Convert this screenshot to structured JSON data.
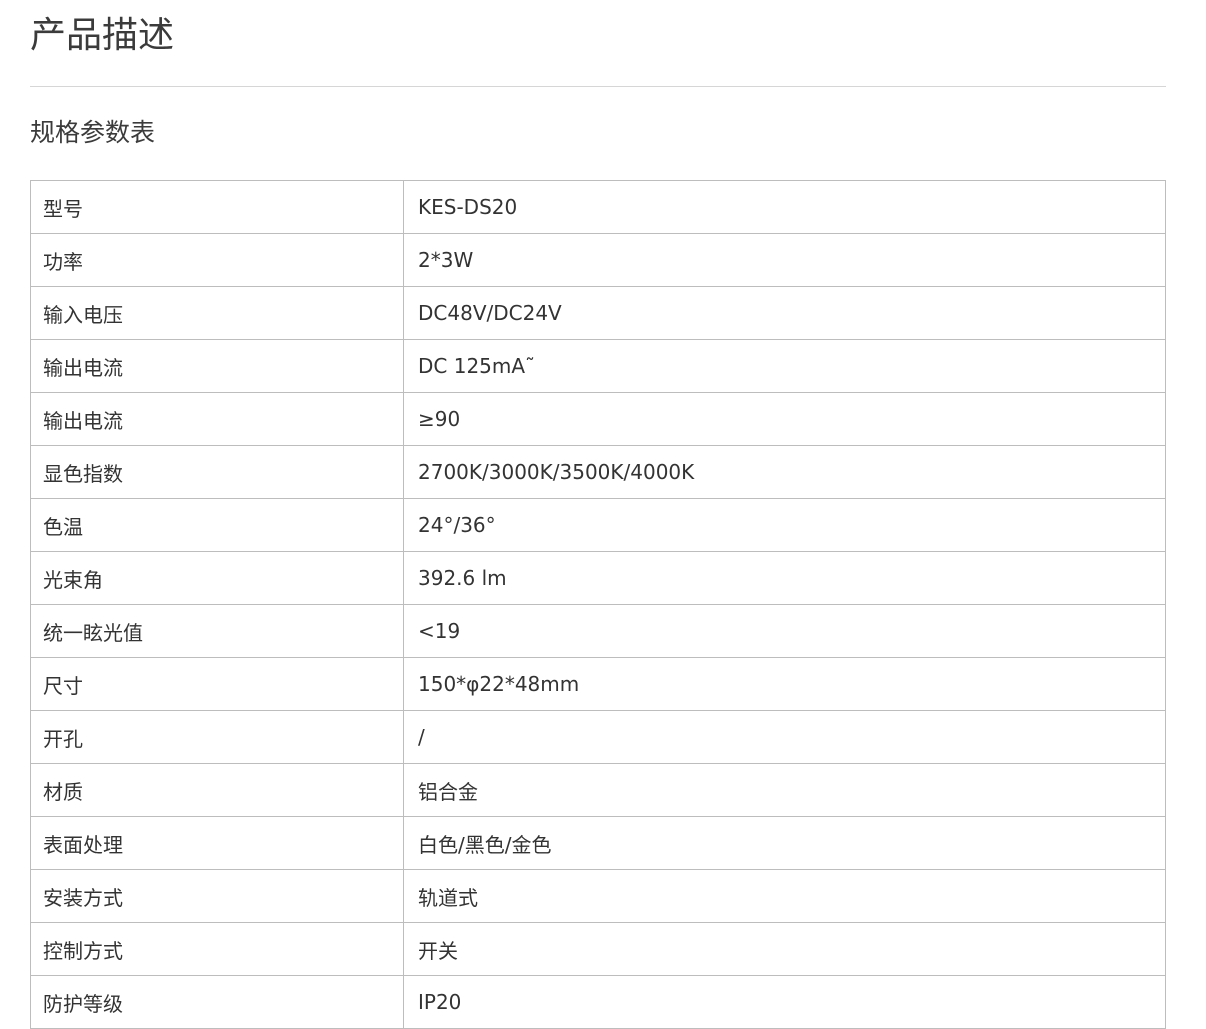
{
  "page": {
    "title": "产品描述",
    "section_title": "规格参数表"
  },
  "spec_table": {
    "rows": [
      {
        "label": "型号",
        "value": "KES-DS20"
      },
      {
        "label": "功率",
        "value": "2*3W"
      },
      {
        "label": "输入电压",
        "value": "DC48V/DC24V"
      },
      {
        "label": "输出电流",
        "value": "DC 125mA˜"
      },
      {
        "label": "输出电流",
        "value": "≥90"
      },
      {
        "label": "显色指数",
        "value": "2700K/3000K/3500K/4000K"
      },
      {
        "label": "色温",
        "value": "24°/36°"
      },
      {
        "label": "光束角",
        "value": "392.6 lm"
      },
      {
        "label": "统一眩光值",
        "value": "<19"
      },
      {
        "label": "尺寸",
        "value": "150*φ22*48mm"
      },
      {
        "label": "开孔",
        "value": "/"
      },
      {
        "label": "材质",
        "value": "铝合金"
      },
      {
        "label": "表面处理",
        "value": "白色/黑色/金色"
      },
      {
        "label": "安装方式",
        "value": "轨道式"
      },
      {
        "label": "控制方式",
        "value": "开关"
      },
      {
        "label": "防护等级",
        "value": "IP20"
      }
    ]
  }
}
